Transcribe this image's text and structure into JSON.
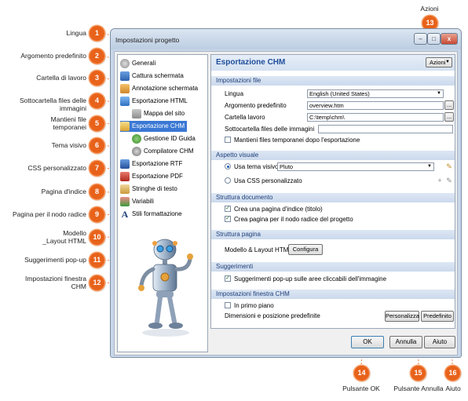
{
  "window": {
    "title": "Impostazioni progetto",
    "controls": {
      "minimize": "–",
      "maximize": "□",
      "close": "x"
    }
  },
  "tree": {
    "items": [
      {
        "label": "Generali",
        "icon": "gear-icon"
      },
      {
        "label": "Cattura schermata",
        "icon": "screenshot-icon"
      },
      {
        "label": "Annotazione schermata",
        "icon": "annotation-icon"
      },
      {
        "label": "Esportazione HTML",
        "icon": "html-export-icon"
      },
      {
        "label": "Mappa del sito",
        "icon": "sitemap-icon"
      },
      {
        "label": "Esportazione CHM",
        "icon": "chm-export-icon"
      },
      {
        "label": "Gestione ID Guida",
        "icon": "help-id-icon"
      },
      {
        "label": "Compilatore CHM",
        "icon": "compiler-icon"
      },
      {
        "label": "Esportazione RTF",
        "icon": "rtf-export-icon"
      },
      {
        "label": "Esportazione PDF",
        "icon": "pdf-export-icon"
      },
      {
        "label": "Stringhe di testo",
        "icon": "strings-icon"
      },
      {
        "label": "Variabili",
        "icon": "variables-icon"
      },
      {
        "label": "Stili formattazione",
        "icon": "styles-icon"
      }
    ]
  },
  "panel": {
    "title": "Esportazione CHM",
    "actions_label": "Azioni",
    "sections": {
      "file": "Impostazioni file",
      "visual": "Aspetto visuale",
      "doc": "Struttura documento",
      "page": "Struttura pagina",
      "tips": "Suggerimenti",
      "window": "Impostazioni finestra CHM"
    },
    "file": {
      "lingua_label": "Lingua",
      "lingua_value": "English (United States)",
      "arg_label": "Argomento predefinito",
      "arg_value": "overview.htm",
      "cartella_label": "Cartella lavoro",
      "cartella_value": "C:\\temp\\chm\\",
      "sotto_label": "Sottocartella files delle immagini",
      "sotto_value": "",
      "mantieni_label": "Mantieni files temporanei dopo l'esportazione",
      "mantieni_checked": false,
      "browse": "..."
    },
    "visual": {
      "usa_tema_label": "Usa tema visivo",
      "tema_value": "Pluto",
      "usa_css_label": "Usa CSS personalizzato"
    },
    "doc": {
      "crea_indice_label": "Crea una pagina d'indice (titolo)",
      "crea_radice_label": "Crea pagina per il nodo radice del progetto"
    },
    "page": {
      "modello_label": "Modello & Layout HTML",
      "configura": "Configura"
    },
    "tips": {
      "popup_label": "Suggerimenti pop-up sulle aree cliccabili dell'immagine"
    },
    "window": {
      "primo_piano_label": "In primo piano",
      "dimensioni_label": "Dimensioni e posizione predefinite",
      "personalizza": "Personalizza",
      "predefinito": "Predefinito"
    }
  },
  "buttons": {
    "ok": "OK",
    "annulla": "Annulla",
    "aiuto": "Aiuto"
  },
  "callouts": [
    {
      "n": "1",
      "text": "Lingua"
    },
    {
      "n": "2",
      "text": "Argomento predefinito"
    },
    {
      "n": "3",
      "text": "Cartella di lavoro"
    },
    {
      "n": "4",
      "text": "Sottocartella files delle immagini"
    },
    {
      "n": "5",
      "text": "Mantieni file temporanei"
    },
    {
      "n": "6",
      "text": "Tema visivo"
    },
    {
      "n": "7",
      "text": "CSS personalizzato"
    },
    {
      "n": "8",
      "text": "Pagina d'indice"
    },
    {
      "n": "9",
      "text": "Pagina per il nodo radice"
    },
    {
      "n": "10",
      "text": "Modello _Layout HTML"
    },
    {
      "n": "11",
      "text": "Suggerimenti pop-up"
    },
    {
      "n": "12",
      "text": "Impostazioni finestra CHM"
    },
    {
      "n": "13",
      "text": "Azioni"
    },
    {
      "n": "14",
      "text": "Pulsante OK"
    },
    {
      "n": "15",
      "text": "Pulsante Annulla"
    },
    {
      "n": "16",
      "text": "Aiuto"
    }
  ],
  "colors": {
    "callout": "#e8621a",
    "accent": "#1f4e9a",
    "selection": "#3a78d4"
  }
}
